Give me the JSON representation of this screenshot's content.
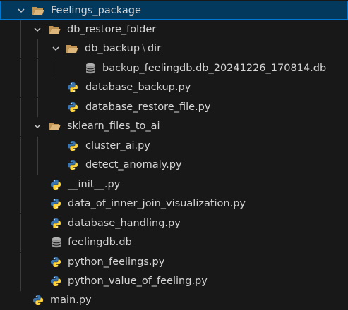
{
  "explorer": {
    "items": [
      {
        "label": "Feelings_package",
        "kind": "folder"
      },
      {
        "label": "db_restore_folder",
        "kind": "folder"
      },
      {
        "label": "db_backup",
        "suffix": "dir",
        "kind": "folder"
      },
      {
        "label": "backup_feelingdb.db_20241226_170814.db",
        "kind": "database"
      },
      {
        "label": "database_backup.py",
        "kind": "python"
      },
      {
        "label": "database_restore_file.py",
        "kind": "python"
      },
      {
        "label": "sklearn_files_to_ai",
        "kind": "folder"
      },
      {
        "label": "cluster_ai.py",
        "kind": "python"
      },
      {
        "label": "detect_anomaly.py",
        "kind": "python"
      },
      {
        "label": "__init__.py",
        "kind": "python"
      },
      {
        "label": "data_of_inner_join_visualization.py",
        "kind": "python"
      },
      {
        "label": "database_handling.py",
        "kind": "python"
      },
      {
        "label": "feelingdb.db",
        "kind": "database"
      },
      {
        "label": "python_feelings.py",
        "kind": "python"
      },
      {
        "label": "python_value_of_feeling.py",
        "kind": "python"
      },
      {
        "label": "main.py",
        "kind": "python"
      }
    ],
    "icons": {
      "folder": "folder-open-icon",
      "python": "python-file-icon",
      "database": "database-file-icon",
      "chevron": "chevron-down-icon"
    },
    "colors": {
      "background": "#181818",
      "selection_border": "#0078d4",
      "folder": "#dcb67a",
      "python_blue": "#3a75b0",
      "python_yellow": "#ffd43b",
      "database": "#b0b0b0"
    }
  }
}
